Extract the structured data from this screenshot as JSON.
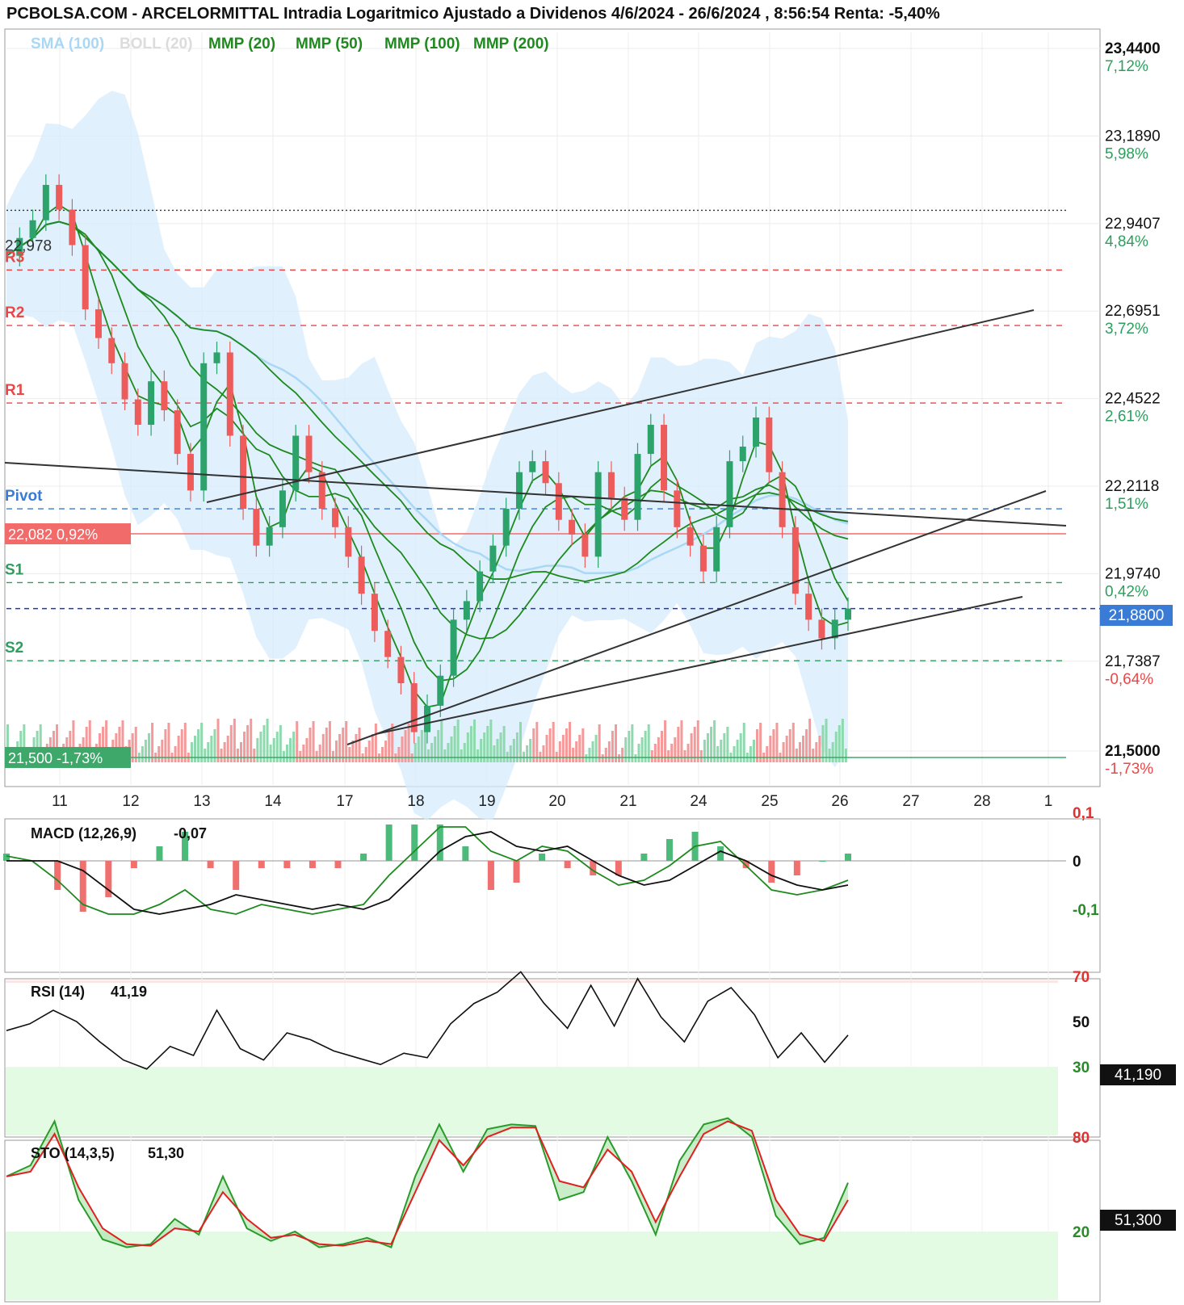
{
  "header": {
    "title": "PCBOLSA.COM - ARCELORMITTAL Intradia Logaritmico Ajustado a Dividenos 4/6/2024 - 26/6/2024 , 8:56:54 Renta: -5,40%"
  },
  "legend": {
    "items": [
      {
        "label": "SMA (100)",
        "color": "#a9d8f5"
      },
      {
        "label": "BOLL (20)",
        "color": "#dcdcdc"
      },
      {
        "label": "MMP (20)",
        "color": "#1e8a1e"
      },
      {
        "label": "MMP (50)",
        "color": "#1e8a1e"
      },
      {
        "label": "MMP (100)",
        "color": "#1e8a1e"
      },
      {
        "label": "MMP (200)",
        "color": "#1e8a1e"
      }
    ]
  },
  "chart_data": {
    "type": "candlestick",
    "x_labels": [
      "11",
      "12",
      "13",
      "14",
      "17",
      "18",
      "19",
      "20",
      "21",
      "24",
      "25",
      "26",
      "27",
      "28",
      "1"
    ],
    "y_axis": {
      "scale": "log",
      "ticks": [
        {
          "price": "23,4400",
          "pct": "7,12%",
          "pct_color": "#2e9e5e",
          "bold": true
        },
        {
          "price": "23,1890",
          "pct": "5,98%",
          "pct_color": "#2e9e5e"
        },
        {
          "price": "22,9407",
          "pct": "4,84%",
          "pct_color": "#2e9e5e"
        },
        {
          "price": "22,6951",
          "pct": "3,72%",
          "pct_color": "#2e9e5e"
        },
        {
          "price": "22,4522",
          "pct": "2,61%",
          "pct_color": "#2e9e5e"
        },
        {
          "price": "22,2118",
          "pct": "1,51%",
          "pct_color": "#2e9e5e"
        },
        {
          "price": "21,9740",
          "pct": "0,42%",
          "pct_color": "#2e9e5e"
        },
        {
          "price": "21,7387",
          "pct": "-0,64%",
          "pct_color": "#e84848"
        },
        {
          "price": "21,5000",
          "pct": "-1,73%",
          "pct_color": "#e84848",
          "bold": true
        }
      ]
    },
    "levels": [
      {
        "label": "22,978",
        "color": "#333333"
      },
      {
        "label": "R3",
        "color": "#e84848"
      },
      {
        "label": "R2",
        "color": "#e84848"
      },
      {
        "label": "R1",
        "color": "#e84848"
      },
      {
        "label": "Pivot",
        "color": "#3a7bd5"
      },
      {
        "label": "S1",
        "color": "#2e9e5e"
      },
      {
        "label": "S2",
        "color": "#2e9e5e"
      }
    ],
    "reference_boxes": [
      {
        "label": "22,082  0,92%",
        "color": "#f26b6b"
      },
      {
        "label": "21,500  -1,73%",
        "color": "#3ea86a"
      }
    ],
    "last_price": "21,8800",
    "ohlc_close": [
      22.85,
      22.9,
      22.95,
      23.05,
      22.98,
      22.88,
      22.7,
      22.62,
      22.55,
      22.45,
      22.38,
      22.5,
      22.42,
      22.3,
      22.2,
      22.55,
      22.58,
      22.35,
      22.15,
      22.05,
      22.1,
      22.2,
      22.35,
      22.25,
      22.15,
      22.1,
      22.02,
      21.92,
      21.82,
      21.75,
      21.68,
      21.55,
      21.62,
      21.7,
      21.85,
      21.9,
      21.98,
      22.05,
      22.15,
      22.25,
      22.28,
      22.22,
      22.12,
      22.08,
      22.02,
      22.25,
      22.18,
      22.12,
      22.3,
      22.38,
      22.2,
      22.1,
      22.05,
      21.98,
      22.1,
      22.28,
      22.32,
      22.4,
      22.25,
      22.1,
      21.92,
      21.85,
      21.8,
      21.85,
      21.88
    ],
    "indicators": {
      "macd": {
        "label": "MACD (12,26,9)",
        "value": "-0,07",
        "ticks": [
          {
            "label": "0,1",
            "color": "#e03030"
          },
          {
            "label": "0",
            "color": "#111111"
          },
          {
            "label": "-0,1",
            "color": "#2a8a2a"
          }
        ],
        "signal": [
          0.0,
          0.0,
          0.0,
          -0.02,
          -0.06,
          -0.1,
          -0.11,
          -0.1,
          -0.09,
          -0.07,
          -0.08,
          -0.09,
          -0.1,
          -0.09,
          -0.1,
          -0.08,
          -0.03,
          0.02,
          0.05,
          0.06,
          0.03,
          0.02,
          0.03,
          0.0,
          -0.03,
          -0.05,
          -0.04,
          -0.01,
          0.02,
          0.0,
          -0.03,
          -0.05,
          -0.06,
          -0.05
        ],
        "macd": [
          0.01,
          0.0,
          -0.04,
          -0.09,
          -0.11,
          -0.11,
          -0.09,
          -0.06,
          -0.1,
          -0.11,
          -0.09,
          -0.1,
          -0.11,
          -0.1,
          -0.09,
          -0.03,
          0.02,
          0.07,
          0.07,
          0.02,
          0.0,
          0.03,
          0.02,
          -0.02,
          -0.05,
          -0.04,
          -0.01,
          0.03,
          0.04,
          -0.01,
          -0.06,
          -0.07,
          -0.06,
          -0.04
        ]
      },
      "rsi": {
        "label": "RSI (14)",
        "value": "41,19",
        "display": "41,190",
        "ticks": [
          {
            "label": "70",
            "color": "#e03030"
          },
          {
            "label": "50",
            "color": "#111111"
          },
          {
            "label": "30",
            "color": "#2a8a2a"
          }
        ],
        "values": [
          46,
          49,
          55,
          50,
          41,
          33,
          29,
          39,
          35,
          55,
          38,
          33,
          45,
          42,
          37,
          34,
          31,
          36,
          34,
          49,
          58,
          63,
          72,
          58,
          47,
          66,
          48,
          69,
          52,
          41,
          59,
          65,
          53,
          34,
          45,
          32,
          44
        ]
      },
      "sto": {
        "label": "STO (14,3,5)",
        "value": "51,30",
        "display": "51,300",
        "ticks": [
          {
            "label": "80",
            "color": "#e03030"
          },
          {
            "label": "20",
            "color": "#2a8a2a"
          }
        ],
        "k": [
          55,
          62,
          90,
          40,
          15,
          10,
          12,
          28,
          18,
          55,
          22,
          14,
          20,
          10,
          12,
          16,
          10,
          55,
          88,
          58,
          85,
          88,
          87,
          40,
          45,
          80,
          52,
          18,
          65,
          88,
          92,
          80,
          30,
          12,
          16,
          51
        ],
        "d": [
          55,
          58,
          82,
          48,
          22,
          12,
          11,
          22,
          20,
          45,
          28,
          16,
          18,
          12,
          11,
          14,
          12,
          45,
          78,
          62,
          80,
          86,
          86,
          52,
          48,
          72,
          58,
          26,
          55,
          82,
          90,
          84,
          40,
          18,
          14,
          40
        ]
      }
    }
  }
}
